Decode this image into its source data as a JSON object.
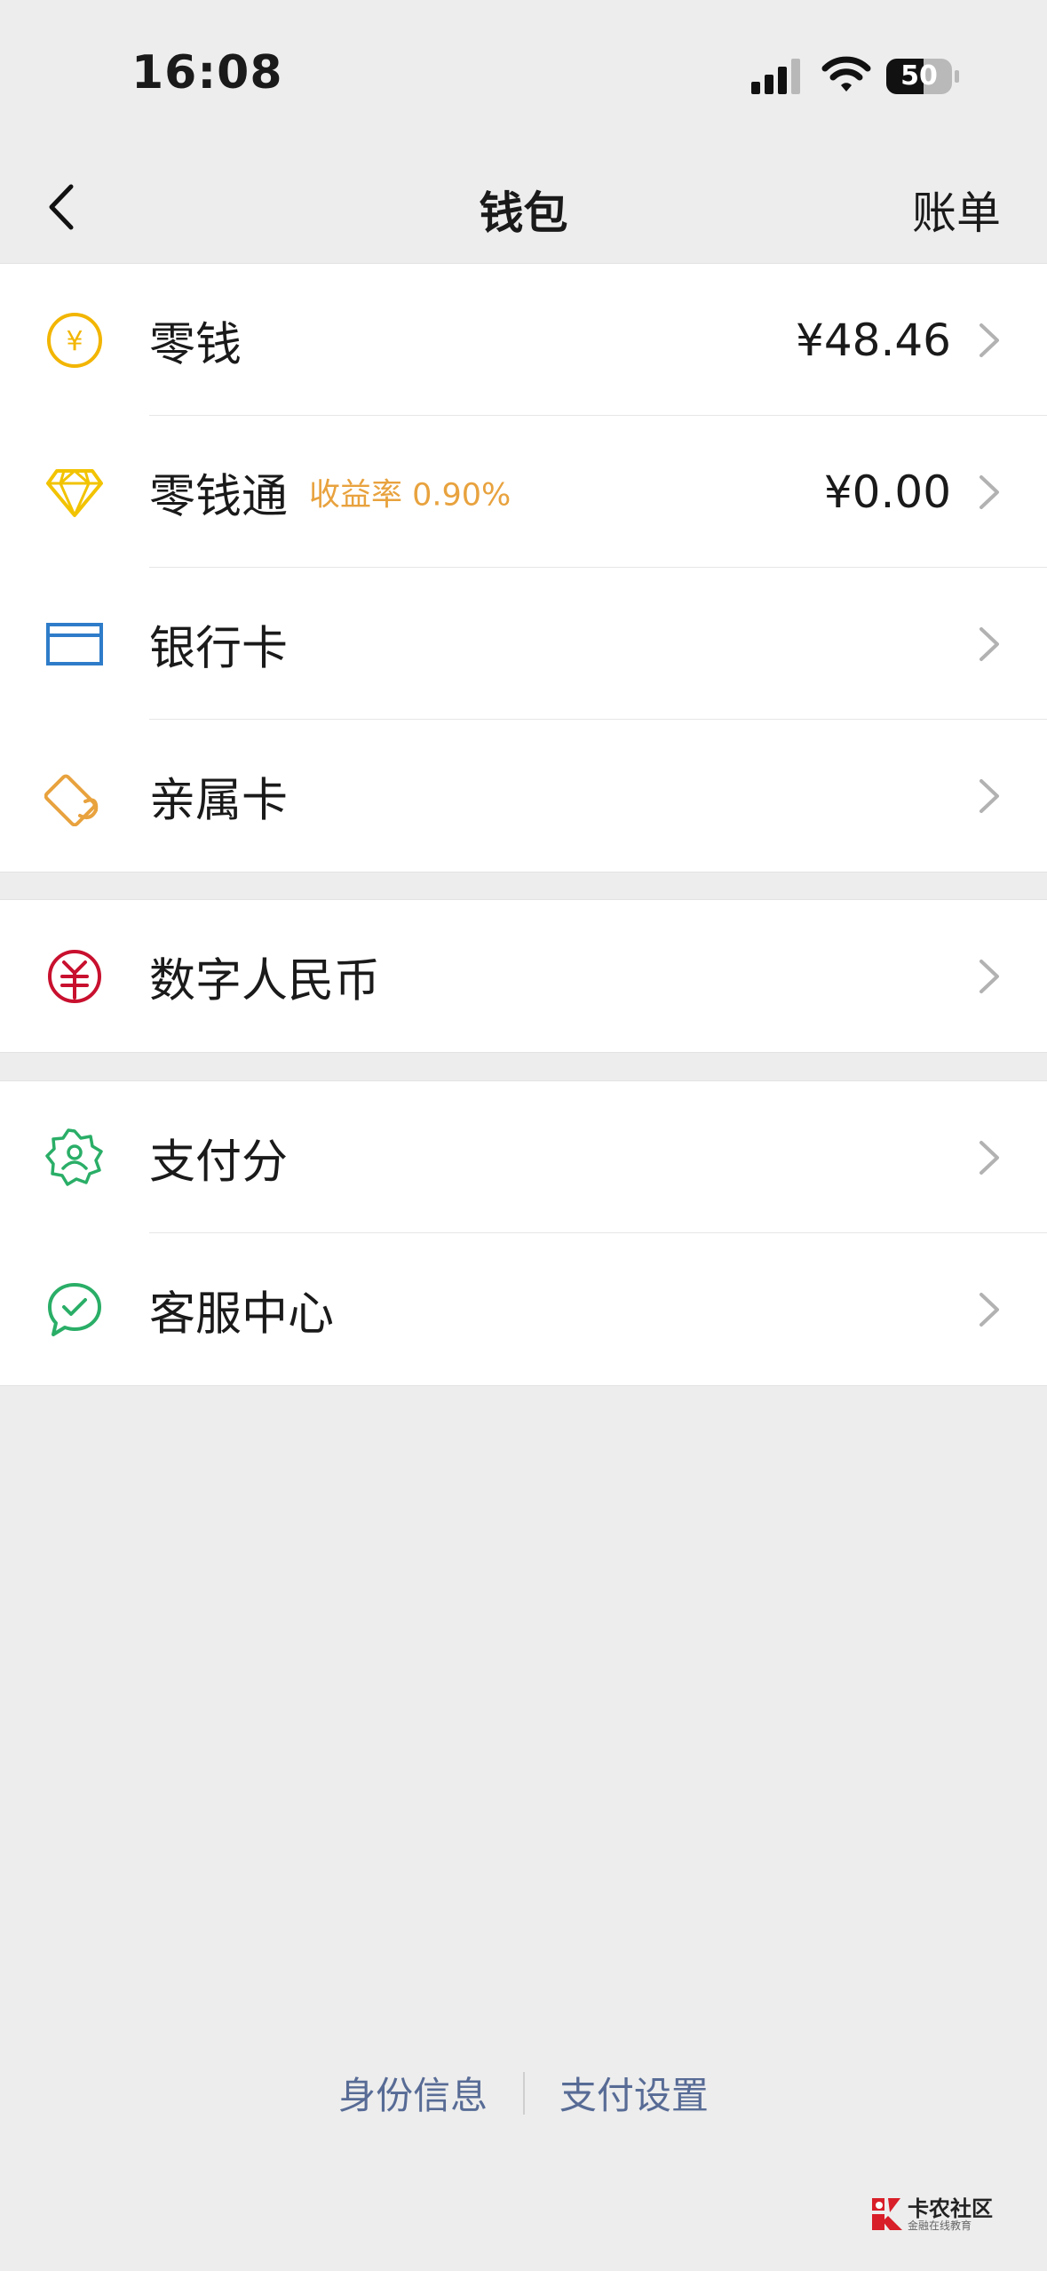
{
  "status": {
    "time": "16:08",
    "battery": "50"
  },
  "nav": {
    "title": "钱包",
    "bill": "账单"
  },
  "group1": [
    {
      "label": "零钱",
      "value": "¥48.46",
      "icon": "yuan-coin-icon",
      "color": "#f2b500"
    },
    {
      "label": "零钱通",
      "tag": "收益率 0.90%",
      "value": "¥0.00",
      "icon": "diamond-icon",
      "color": "#f2c300"
    },
    {
      "label": "银行卡",
      "icon": "bank-card-icon",
      "color": "#2e7cc9"
    },
    {
      "label": "亲属卡",
      "icon": "family-card-icon",
      "color": "#e8a23e"
    }
  ],
  "group2": [
    {
      "label": "数字人民币",
      "icon": "digital-rmb-icon",
      "color": "#c8102e"
    }
  ],
  "group3": [
    {
      "label": "支付分",
      "icon": "pay-score-icon",
      "color": "#2aae67"
    },
    {
      "label": "客服中心",
      "icon": "customer-service-icon",
      "color": "#2aae67"
    }
  ],
  "footer": {
    "identity": "身份信息",
    "settings": "支付设置"
  },
  "watermark": {
    "name": "卡农社区",
    "slogan": "金融在线教育"
  }
}
